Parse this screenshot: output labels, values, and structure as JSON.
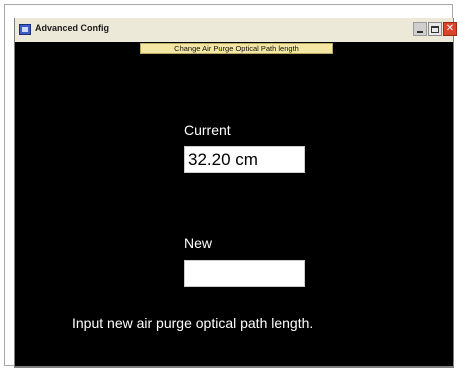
{
  "window": {
    "title": "Advanced Config",
    "subtitle": "Change Air Purge Optical Path length",
    "close_glyph": "✕"
  },
  "icons": {
    "app": "app-window-icon",
    "minimize": "minimize-icon",
    "maximize": "maximize-icon",
    "close": "close-icon"
  },
  "form": {
    "current_label": "Current",
    "current_value": "32.20 cm",
    "new_label": "New",
    "new_value": ""
  },
  "instruction": "Input new air purge optical path length.",
  "colors": {
    "background": "#000000",
    "text": "#ffffff",
    "subtitle_bar": "#f4e7a3",
    "close_button": "#d9452a"
  }
}
